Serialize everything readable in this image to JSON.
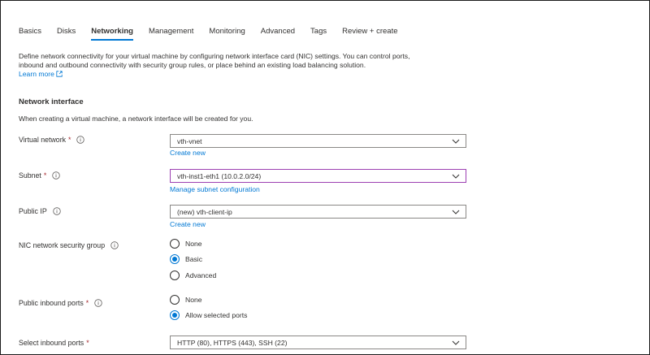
{
  "tabs": [
    {
      "label": "Basics"
    },
    {
      "label": "Disks"
    },
    {
      "label": "Networking",
      "active": true
    },
    {
      "label": "Management"
    },
    {
      "label": "Monitoring"
    },
    {
      "label": "Advanced"
    },
    {
      "label": "Tags"
    },
    {
      "label": "Review + create"
    }
  ],
  "intro": {
    "line1": "Define network connectivity for your virtual machine by configuring network interface card (NIC) settings. You can control ports,",
    "line2": "inbound and outbound connectivity with security group rules, or place behind an existing load balancing solution.",
    "learn_more": "Learn more"
  },
  "section": {
    "title": "Network interface",
    "description": "When creating a virtual machine, a network interface will be created for you."
  },
  "fields": {
    "virtual_network": {
      "label": "Virtual network",
      "required": "*",
      "value": "vth-vnet",
      "link": "Create new"
    },
    "subnet": {
      "label": "Subnet",
      "required": "*",
      "value": "vth-inst1-eth1 (10.0.2.0/24)",
      "link": "Manage subnet configuration"
    },
    "public_ip": {
      "label": "Public IP",
      "value": "(new) vth-client-ip",
      "link": "Create new"
    },
    "nic_nsg": {
      "label": "NIC network security group",
      "options": [
        "None",
        "Basic",
        "Advanced"
      ],
      "selected": "Basic"
    },
    "public_inbound_ports": {
      "label": "Public inbound ports",
      "required": "*",
      "options": [
        "None",
        "Allow selected ports"
      ],
      "selected": "Allow selected ports"
    },
    "select_inbound_ports": {
      "label": "Select inbound ports",
      "required": "*",
      "value": "HTTP (80), HTTPS (443), SSH (22)"
    }
  },
  "colors": {
    "accent": "#0078d4",
    "required": "#a4262c",
    "focus_border": "#9c3fb2"
  }
}
